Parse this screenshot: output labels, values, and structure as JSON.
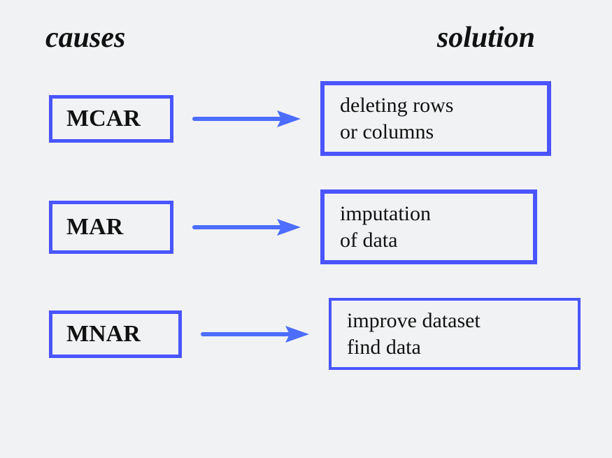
{
  "headers": {
    "left": "causes",
    "right": "solution"
  },
  "colors": {
    "border": "#4a55ff",
    "arrow": "#4d6dff",
    "background": "#f1f2f3"
  },
  "rows": [
    {
      "cause": "MCAR",
      "solution": "deleting rows\nor columns"
    },
    {
      "cause": "MAR",
      "solution": "imputation\nof data"
    },
    {
      "cause": "MNAR",
      "solution": "improve dataset\nfind data"
    }
  ]
}
